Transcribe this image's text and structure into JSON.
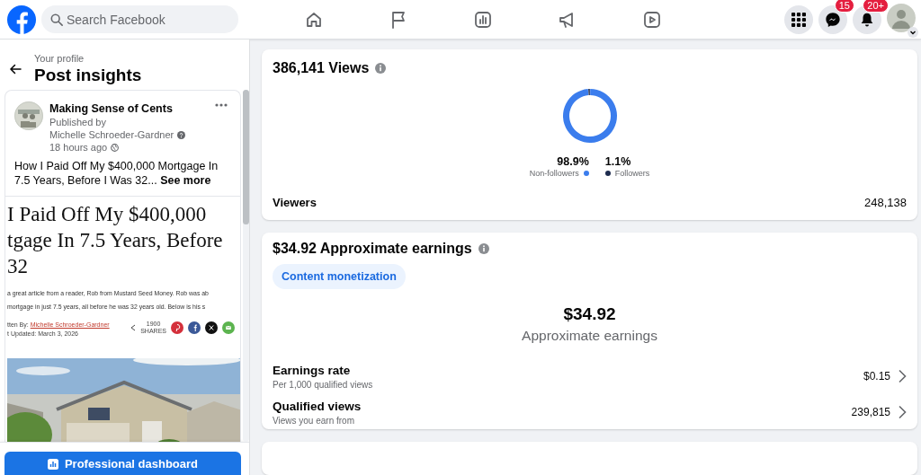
{
  "top_bar": {
    "search": {
      "placeholder": "Search Facebook"
    },
    "messenger_badge": "15",
    "notifications_badge": "20+"
  },
  "left_panel": {
    "breadcrumb": "Your profile",
    "title": "Post insights",
    "post": {
      "page_name": "Making Sense of Cents",
      "published_by": "Published by",
      "author": "Michelle Schroeder-Gardner",
      "time": "18 hours ago",
      "text": "How I Paid Off My $400,000 Mortgage In 7.5 Years, Before I Was 32...",
      "see_more": "See more",
      "link_preview": {
        "headline_lines": [
          "I Paid Off My $400,000",
          "tgage In 7.5 Years, Before",
          "32"
        ],
        "excerpt_lines": [
          "a great article from a reader, Rob from Mustard Seed Money. Rob was ab",
          "mortgage in just 7.5 years, all before he was 32 years old. Below is his s"
        ],
        "byline_label": "tten By:",
        "byline_author": "Michelle Schroeder-Gardner",
        "updated": "t Updated: March 3, 2026",
        "share_count": "1900",
        "share_label": "SHARES",
        "kind": "picture"
      }
    },
    "dashboard_button": "Professional dashboard"
  },
  "views_card": {
    "title": "386,141 Views",
    "chart_data": {
      "type": "donut",
      "categories": [
        "Non-followers",
        "Followers"
      ],
      "values": [
        98.9,
        1.1
      ]
    },
    "legend": [
      {
        "percent": "98.9%",
        "color": "#3b7ded"
      },
      {
        "percent": "1.1%",
        "color": "#1e2c4f"
      }
    ],
    "viewers_label": "Viewers",
    "viewers_value": "248,138"
  },
  "earnings_card": {
    "title": "$34.92 Approximate earnings",
    "tag": "Content monetization",
    "amount": "$34.92",
    "amount_label": "Approximate earnings",
    "rows": [
      {
        "label": "Earnings rate",
        "sublabel": "Per 1,000 qualified views",
        "value": "$0.15"
      },
      {
        "label": "Qualified views",
        "sublabel": "Views you earn from",
        "value": "239,815"
      }
    ]
  }
}
